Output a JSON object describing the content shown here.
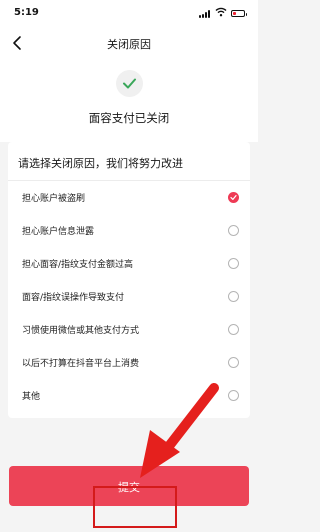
{
  "status_bar": {
    "time": "5:19"
  },
  "nav": {
    "title": "关闭原因"
  },
  "result": {
    "title": "面容支付已关闭"
  },
  "form": {
    "prompt": "请选择关闭原因，我们将努力改进",
    "reasons": [
      {
        "label": "担心账户被盗刷",
        "selected": true
      },
      {
        "label": "担心账户信息泄露",
        "selected": false
      },
      {
        "label": "担心面容/指纹支付金额过高",
        "selected": false
      },
      {
        "label": "面容/指纹误操作导致支付",
        "selected": false
      },
      {
        "label": "习惯使用微信或其他支付方式",
        "selected": false
      },
      {
        "label": "以后不打算在抖音平台上消费",
        "selected": false
      },
      {
        "label": "其他",
        "selected": false
      }
    ]
  },
  "submit": {
    "label": "提交"
  },
  "colors": {
    "accent": "#ec4457",
    "check": "#3aa75a",
    "annotation": "#d41a1a"
  }
}
